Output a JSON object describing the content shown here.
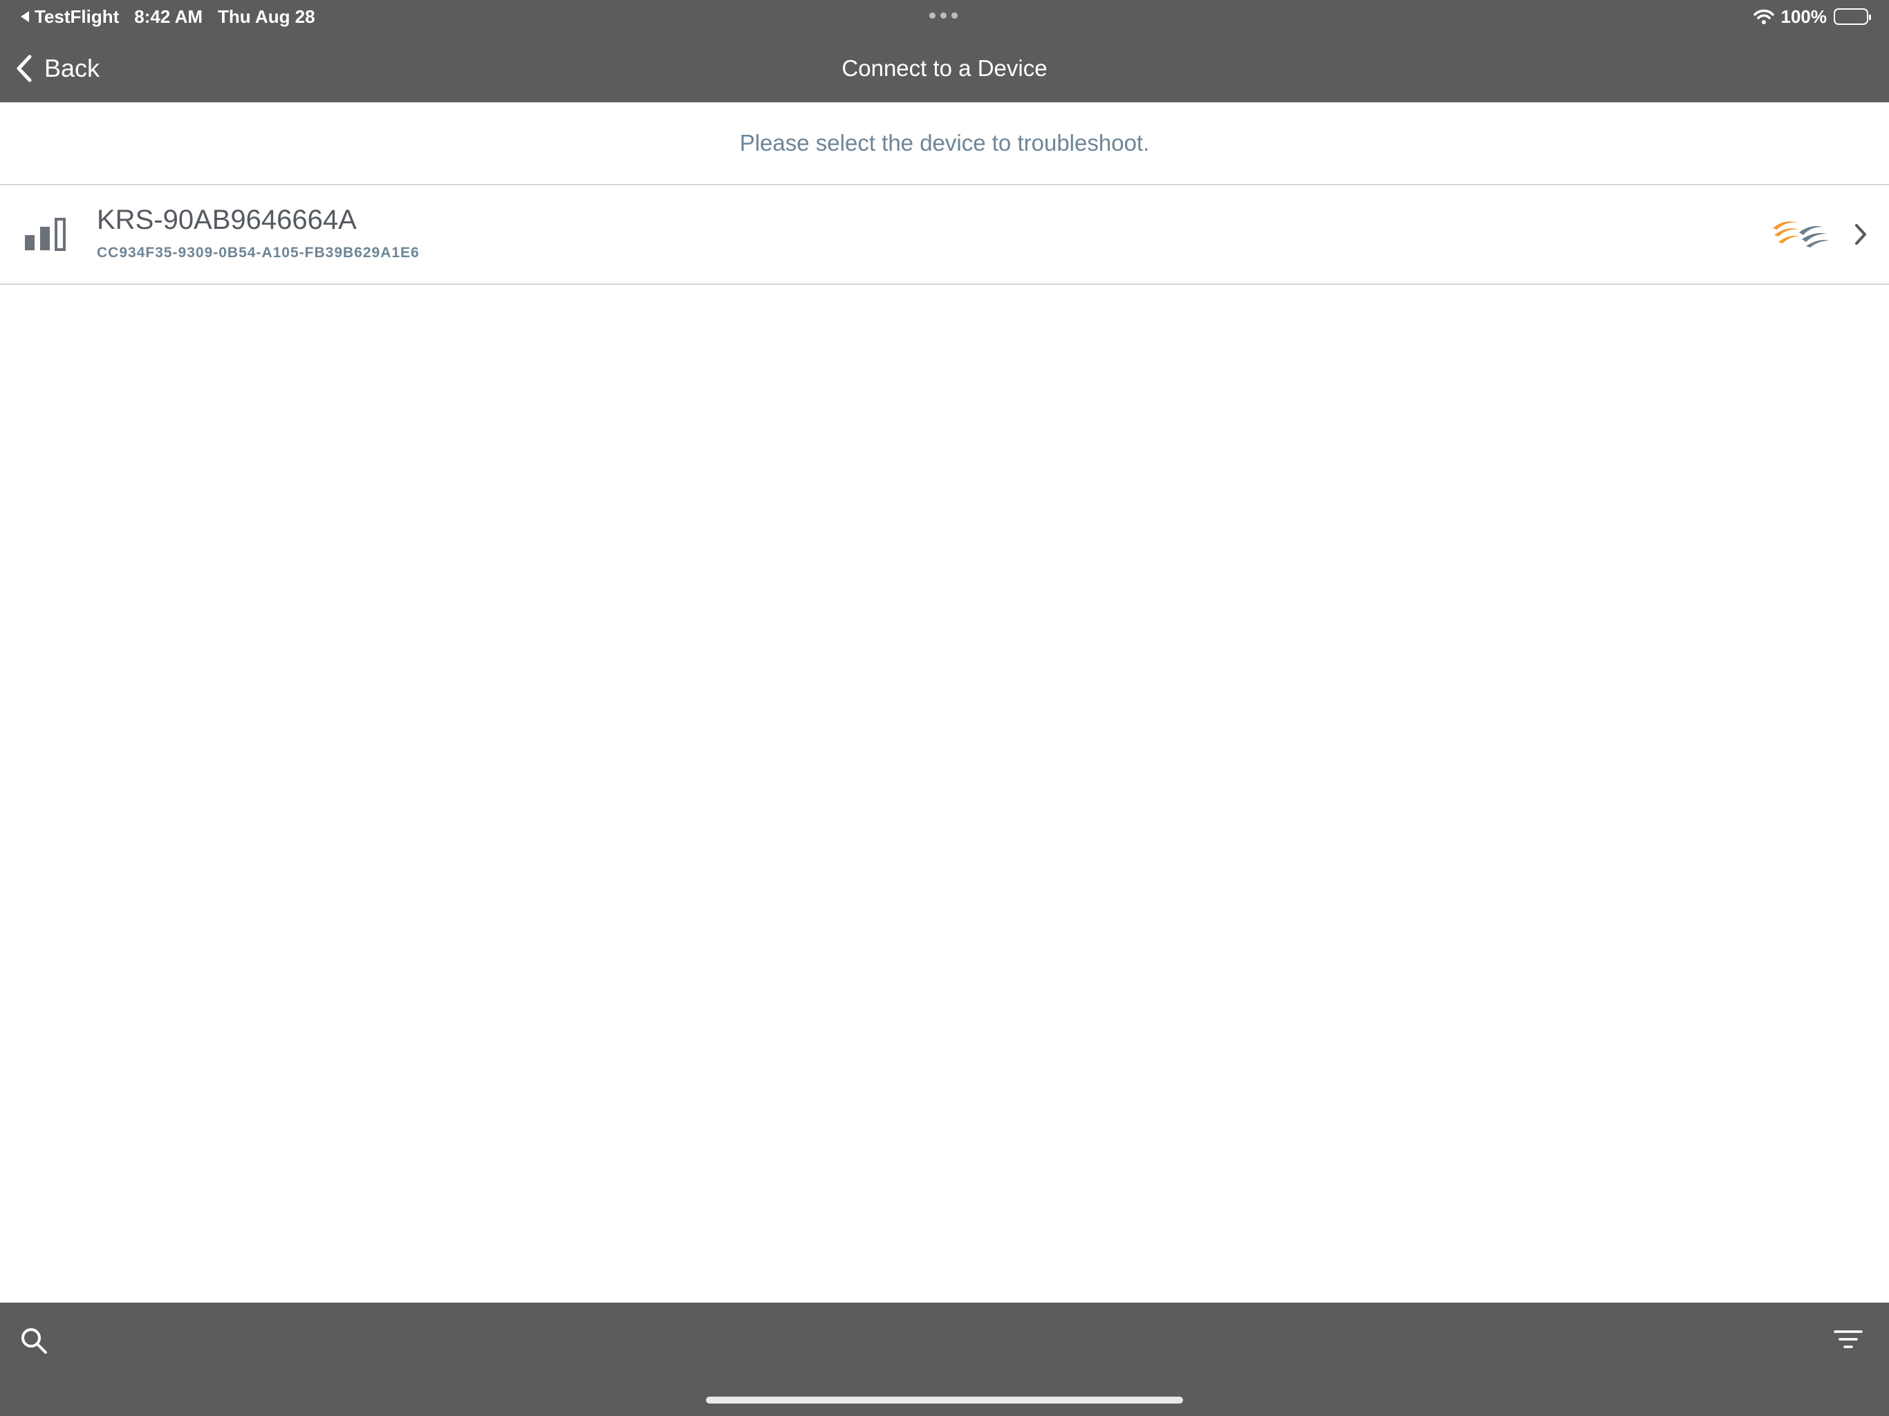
{
  "status_bar": {
    "back_app": "TestFlight",
    "time": "8:42 AM",
    "date": "Thu Aug 28",
    "battery": "100%"
  },
  "nav": {
    "back_label": "Back",
    "title": "Connect to a Device"
  },
  "prompt": "Please select the device to troubleshoot.",
  "devices": [
    {
      "name": "KRS-90AB9646664A",
      "id": "CC934F35-9309-0B54-A105-FB39B629A1E6"
    }
  ],
  "icons": {
    "nav_back": "chevron-left-icon",
    "signal": "signal-strength-icon",
    "brand": "brand-logo-icon",
    "row_chevron": "chevron-right-icon",
    "search": "search-icon",
    "filter": "filter-icon"
  },
  "colors": {
    "chrome": "#5c5c5c",
    "prompt_text": "#6d8596",
    "device_name": "#555a60",
    "logo_orange": "#f39a2e",
    "logo_gray": "#6e7f8d"
  }
}
